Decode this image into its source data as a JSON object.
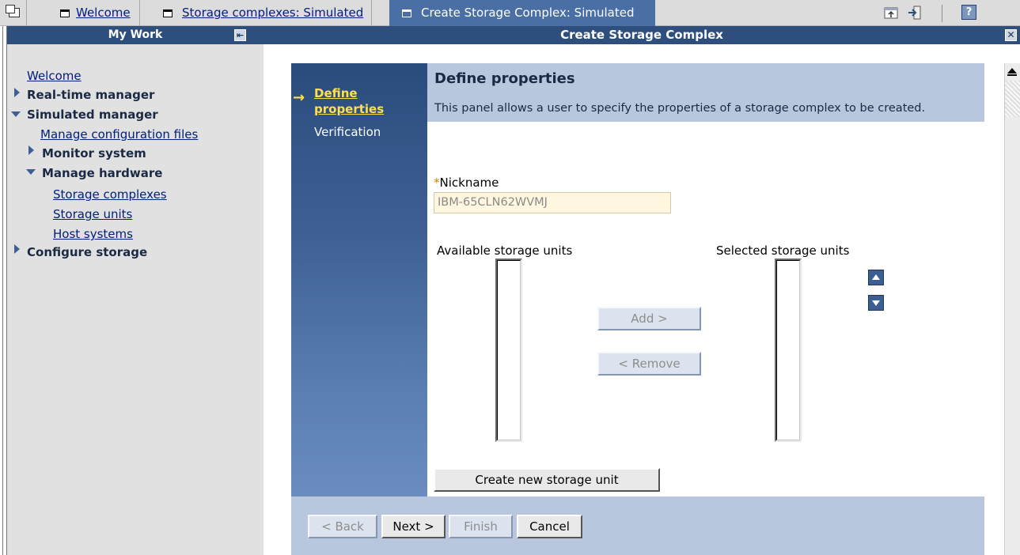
{
  "tabs": [
    {
      "label": "Welcome"
    },
    {
      "label": "Storage complexes: Simulated"
    },
    {
      "label": "Create Storage Complex: Simulated"
    }
  ],
  "toolbar": {
    "icons": [
      "panel-toggle-icon",
      "launch-icon",
      "logout-icon",
      "help-icon"
    ],
    "help_label": "?"
  },
  "mywork": {
    "title": "My Work",
    "collapse_glyph": "⇤",
    "items": [
      {
        "label": "Welcome"
      },
      {
        "label": "Real-time manager"
      },
      {
        "label": "Simulated manager"
      },
      {
        "label": "Manage configuration files"
      },
      {
        "label": "Monitor system"
      },
      {
        "label": "Manage hardware"
      },
      {
        "label": "Storage complexes"
      },
      {
        "label": "Storage units"
      },
      {
        "label": "Host systems"
      },
      {
        "label": "Configure storage"
      }
    ]
  },
  "content": {
    "title": "Create Storage Complex",
    "close_glyph": "✕"
  },
  "wizard": {
    "arrow": "→",
    "steps": [
      {
        "label_line1": "Define",
        "label_line2": "properties"
      },
      {
        "label": "Verification"
      }
    ]
  },
  "form": {
    "title": "Define properties",
    "description": "This panel allows a user to specify the properties of a storage complex to be created.",
    "nickname_required_mark": "*",
    "nickname_label": "Nickname",
    "nickname_value": "IBM-65CLN62WVMJ",
    "available_label": "Available storage units",
    "selected_label": "Selected storage units",
    "add_label": "Add >",
    "remove_label": "< Remove",
    "create_unit_label": "Create new storage unit"
  },
  "footer": {
    "back_label": "< Back",
    "next_label": "Next >",
    "finish_label": "Finish",
    "cancel_label": "Cancel"
  },
  "colors": {
    "header_blue": "#2e4f7e",
    "active_tab": "#4a6fa5",
    "band": "#b8c7dd",
    "highlight_yellow": "#ffde52"
  }
}
